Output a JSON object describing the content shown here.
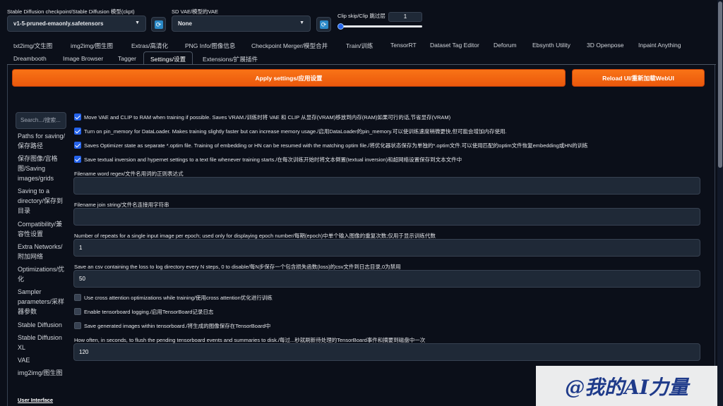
{
  "top": {
    "checkpoint_label": "Stable Diffusion checkpoint/Stable Diffusion 模型(ckpt)",
    "checkpoint_value": "v1-5-pruned-emaonly.safetensors",
    "vae_label": "SD VAE/模型的VAE",
    "vae_value": "None",
    "clip_label": "Clip skip/Clip 跳过层",
    "clip_value": "1",
    "clip_slider_fraction": 0.0,
    "refresh_glyph": "⟳"
  },
  "tabs": {
    "row1": [
      "txt2img/文生图",
      "img2img/图生图",
      "Extras/高清化",
      "PNG Info/图像信息",
      "Checkpoint Merger/模型合并",
      "Train/训练",
      "TensorRT",
      "Dataset Tag Editor",
      "Deforum",
      "Ebsynth Utility",
      "3D Openpose",
      "Inpaint Anything"
    ],
    "row2": [
      "Dreambooth",
      "Image Browser",
      "Tagger",
      "Settings/设置",
      "Extensions/扩展插件"
    ]
  },
  "actions": {
    "apply": "Apply settings/应用设置",
    "reload": "Reload UI/重新加载WebUI"
  },
  "sidebar": {
    "search_placeholder": "Search.../搜索...",
    "items": [
      "Paths for saving/保存路径",
      "保存图像/宫格图/Saving images/grids",
      "Saving to a directory/保存到目录",
      "Compatibility/兼容性设置",
      "Extra Networks/附加网络",
      "Optimizations/优化",
      "Sampler parameters/采样器参数",
      "Stable Diffusion",
      "Stable Diffusion XL",
      "VAE",
      "img2img/图生图"
    ],
    "bottom_item": "User Interface"
  },
  "settings": {
    "checks_top": [
      {
        "label": "Move VAE and CLIP to RAM when training if possible. Saves VRAM./训练时将 VAE 和 CLIP 从显存(VRAM)移放到内存(RAM)如果可行的话,节省显存(VRAM)",
        "checked": true
      },
      {
        "label": "Turn on pin_memory for DataLoader. Makes training slightly faster but can increase memory usage./启用DataLoader的pin_memory.可以使训练速度稍微更快,但可能会增加内存使用.",
        "checked": true
      },
      {
        "label": "Saves Optimizer state as separate *.optim file. Training of embedding or HN can be resumed with the matching optim file./将优化器状态保存为单独的*.optim文件.可以使用匹配的optim文件恢复embedding或HN的训练",
        "checked": true
      },
      {
        "label": "Save textual inversion and hypernet settings to a text file whenever training starts./在每次训练开始时将文本倒置(textual inversion)和超网络设置保存到文本文件中",
        "checked": true
      }
    ],
    "filename_regex_label": "Filename word regex/文件名用词的正则表达式",
    "filename_regex_value": "",
    "filename_join_label": "Filename join string/文件名连接用字符串",
    "filename_join_value": "",
    "repeats_label": "Number of repeats for a single input image per epoch; used only for displaying epoch number/每期(epoch)中单个输入图像的重复次数;仅用于显示训练代数",
    "repeats_value": "1",
    "csv_label": "Save an csv containing the loss to log directory every N steps, 0 to disable/每N步保存一个包含损失函数(loss)的csv文件到日志目录,0为禁用",
    "csv_value": "50",
    "checks_bottom": [
      {
        "label": "Use cross attention optimizations while training/使用cross attention优化进行训练",
        "checked": false
      },
      {
        "label": "Enable tensorboard logging./启用TensorBoard记录日志",
        "checked": false
      },
      {
        "label": "Save generated images within tensorboard./将生成的图像保存在TensorBoard中",
        "checked": false
      }
    ],
    "flush_label": "How often, in seconds, to flush the pending tensorboard events and summaries to disk./每过...秒就刷新待处理的TensorBoard事件和摘要到磁盘中一次",
    "flush_value": "120"
  },
  "watermark": "@我的AI力量"
}
